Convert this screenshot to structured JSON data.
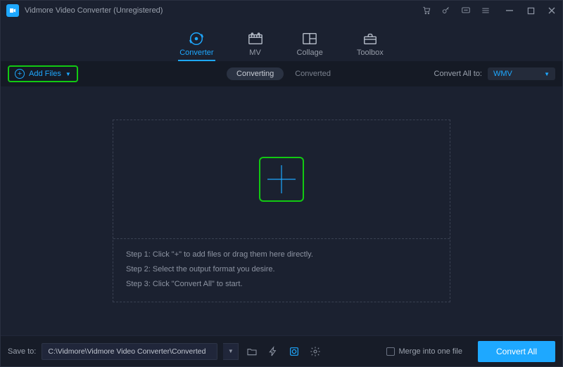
{
  "titlebar": {
    "title": "Vidmore Video Converter (Unregistered)"
  },
  "mainnav": {
    "tabs": [
      {
        "label": "Converter",
        "icon": "converter-icon",
        "active": true
      },
      {
        "label": "MV",
        "icon": "mv-icon",
        "active": false
      },
      {
        "label": "Collage",
        "icon": "collage-icon",
        "active": false
      },
      {
        "label": "Toolbox",
        "icon": "toolbox-icon",
        "active": false
      }
    ]
  },
  "toolbar": {
    "add_files_label": "Add Files",
    "sub_tabs": {
      "converting": "Converting",
      "converted": "Converted"
    },
    "convert_all_to_label": "Convert All to:",
    "convert_all_to_value": "WMV"
  },
  "dropzone": {
    "step1": "Step 1: Click \"+\" to add files or drag them here directly.",
    "step2": "Step 2: Select the output format you desire.",
    "step3": "Step 3: Click \"Convert All\" to start."
  },
  "footer": {
    "save_to_label": "Save to:",
    "save_to_path": "C:\\Vidmore\\Vidmore Video Converter\\Converted",
    "merge_label": "Merge into one file",
    "convert_all_label": "Convert All"
  }
}
